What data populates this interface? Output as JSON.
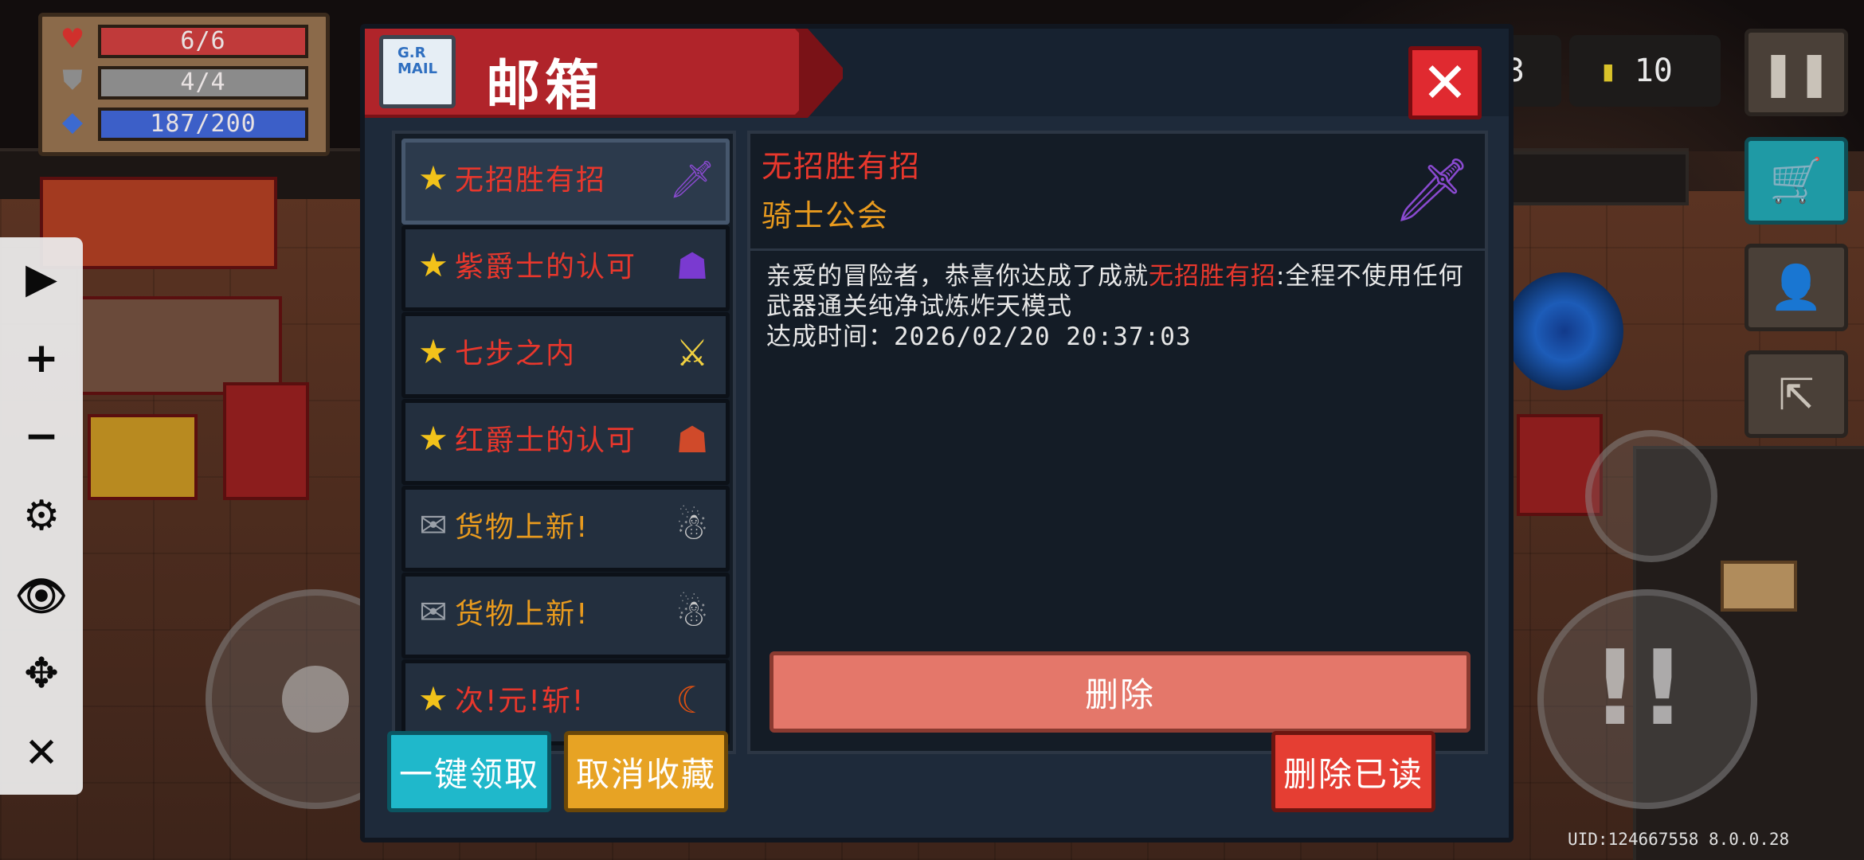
{
  "hud": {
    "hp": "6/6",
    "armor": "4/4",
    "energy": "187/200",
    "coins_partial": "3",
    "gems": "10"
  },
  "mailbox": {
    "title": "邮箱",
    "icon_text": "G.R\nMAIL",
    "items": [
      {
        "label": "无招胜有招",
        "type": "star",
        "color": "red",
        "selected": true
      },
      {
        "label": "紫爵士的认可",
        "type": "star",
        "color": "red"
      },
      {
        "label": "七步之内",
        "type": "star",
        "color": "red"
      },
      {
        "label": "红爵士的认可",
        "type": "star",
        "color": "red"
      },
      {
        "label": "货物上新!",
        "type": "mail",
        "color": "orange"
      },
      {
        "label": "货物上新!",
        "type": "mail",
        "color": "orange"
      },
      {
        "label": "次!元!斩!",
        "type": "star",
        "color": "red"
      }
    ],
    "detail": {
      "title": "无招胜有招",
      "sender": "骑士公会",
      "body_prefix": "亲爱的冒险者，恭喜你达成了成就",
      "body_highlight": "无招胜有招",
      "body_suffix": ":全程不使用任何武器通关纯净试炼炸天模式",
      "time_label": "达成时间：",
      "time_value": "2026/02/20 20:37:03",
      "delete_label": "删除"
    },
    "buttons": {
      "claim_all": "一键领取",
      "unfavorite": "取消收藏",
      "delete_read": "删除已读"
    }
  },
  "footer": {
    "uid": "UID:124667558 8.0.0.28"
  },
  "colors": {
    "highlight_red": "#e8372c",
    "sender_orange": "#e89a1e",
    "window_bg": "#1e2a3a"
  }
}
